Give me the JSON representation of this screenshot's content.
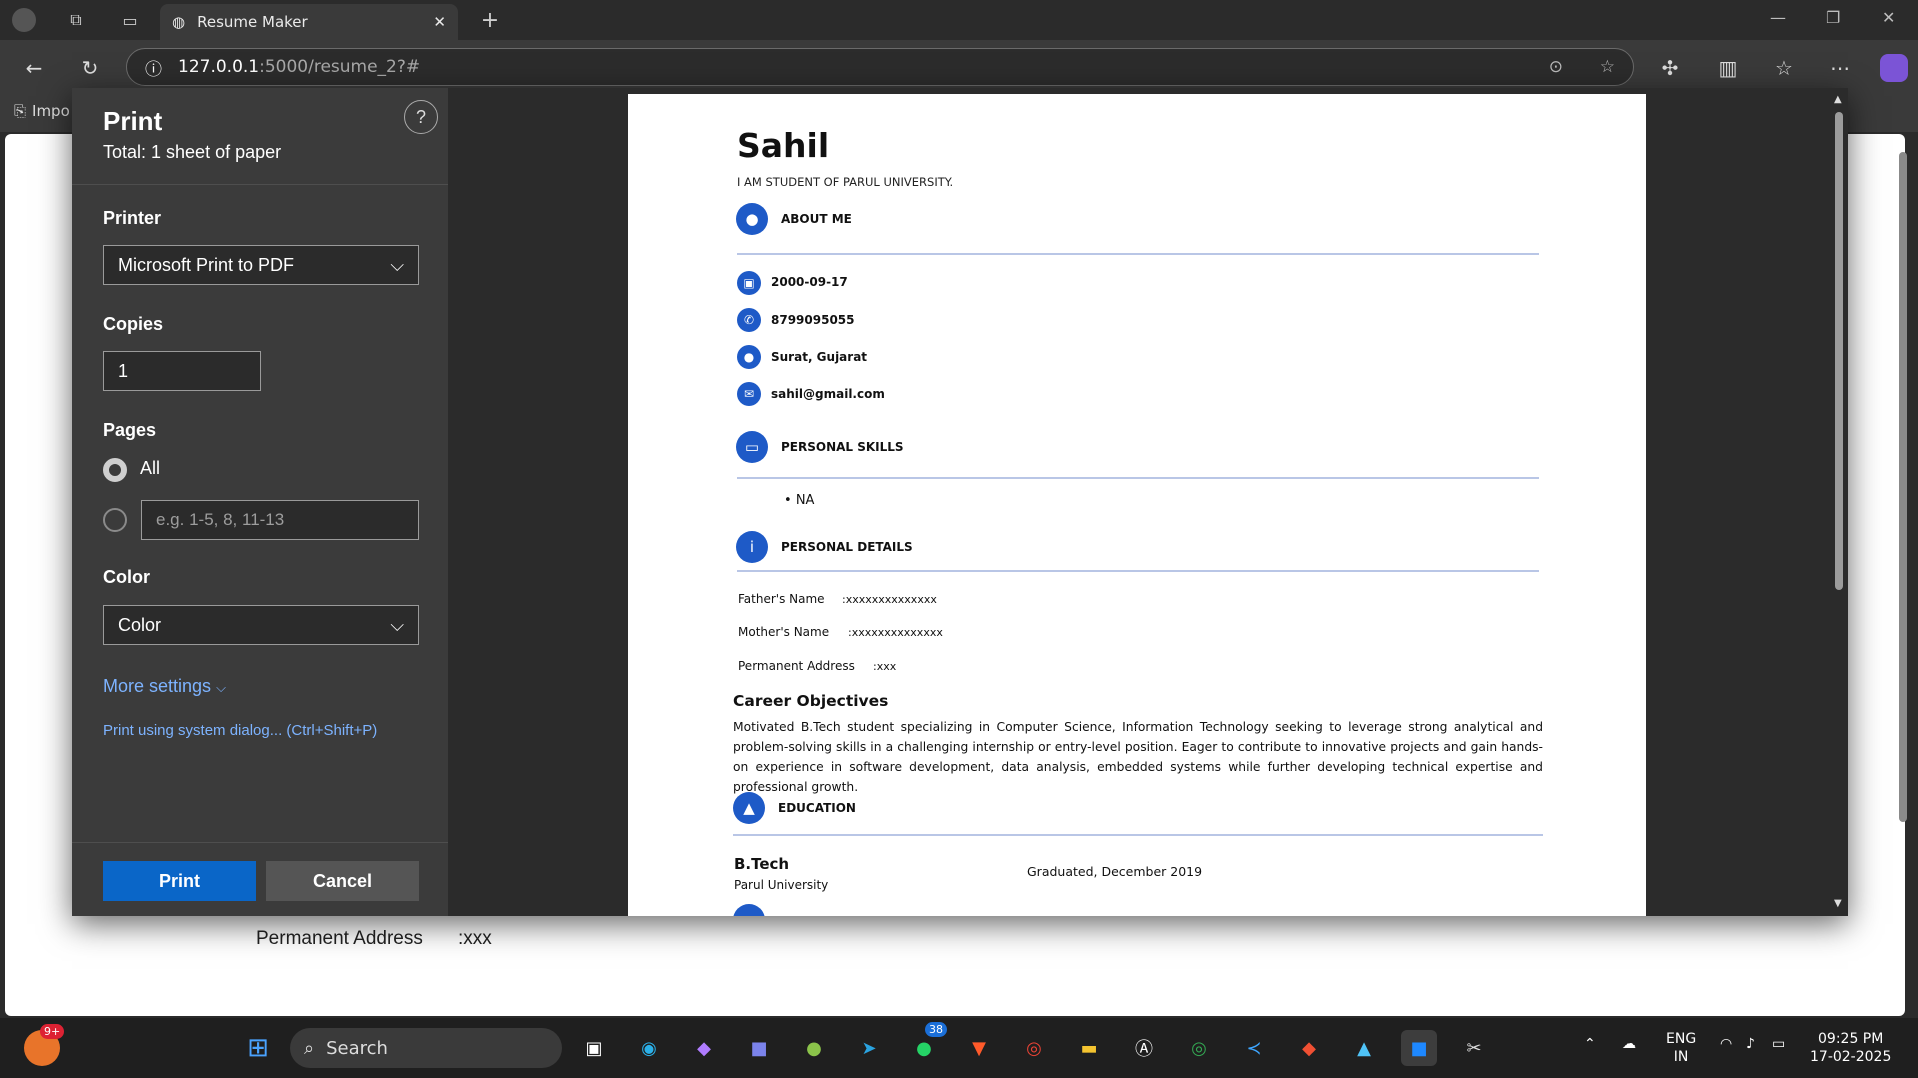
{
  "browser": {
    "tab_title": "Resume Maker",
    "url_host": "127.0.0.1",
    "url_path": ":5000/resume_2?#",
    "fav_item": "Impo"
  },
  "background_page": {
    "perm_label": "Permanent Address",
    "perm_value": ":xxx"
  },
  "print_dialog": {
    "title": "Print",
    "total": "Total: 1 sheet of paper",
    "help": "?",
    "printer_label": "Printer",
    "printer_value": "Microsoft Print to PDF",
    "copies_label": "Copies",
    "copies_value": "1",
    "pages_label": "Pages",
    "pages_all": "All",
    "pages_placeholder": "e.g. 1-5, 8, 11-13",
    "color_label": "Color",
    "color_value": "Color",
    "more_settings": "More settings",
    "system_dialog": "Print using system dialog... (Ctrl+Shift+P)",
    "print_button": "Print",
    "cancel_button": "Cancel"
  },
  "resume": {
    "name": "Sahil",
    "subtitle": "I AM STUDENT OF PARUL UNIVERSITY.",
    "about_title": "ABOUT ME",
    "dob": "2000-09-17",
    "phone": "8799095055",
    "location": "Surat, Gujarat",
    "email": "sahil@gmail.com",
    "skills_title": "PERSONAL SKILLS",
    "skill": "NA",
    "details_title": "PERSONAL DETAILS",
    "father_label": "Father's Name",
    "father_value": ":xxxxxxxxxxxxxx",
    "mother_label": "Mother's Name",
    "mother_value": ":xxxxxxxxxxxxxx",
    "perm_label": "Permanent Address",
    "perm_value": ":xxx",
    "career_title": "Career Objectives",
    "career_text": "Motivated B.Tech student specializing in Computer Science, Information Technology seeking to leverage strong analytical and problem-solving skills in a challenging internship or entry-level position. Eager to contribute to innovative projects and gain hands-on experience in software development, data analysis, embedded systems while further developing technical expertise and professional growth.",
    "education_title": "EDUCATION",
    "degree": "B.Tech",
    "university": "Parul University",
    "graduated": "Graduated, December 2019"
  },
  "taskbar": {
    "search": "Search",
    "widget_badge": "9+",
    "whatsapp_badge": "38",
    "lang": "ENG",
    "region": "IN",
    "time": "09:25 PM",
    "date": "17-02-2025"
  }
}
